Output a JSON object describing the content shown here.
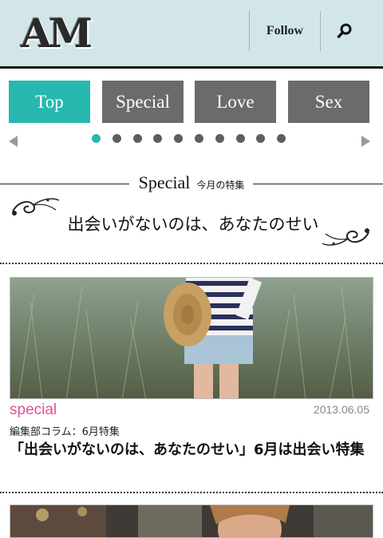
{
  "header": {
    "logo": "AM",
    "follow_label": "Follow",
    "search_icon": "search-icon"
  },
  "tabs": [
    {
      "label": "Top",
      "active": true
    },
    {
      "label": "Special",
      "active": false
    },
    {
      "label": "Love",
      "active": false
    },
    {
      "label": "Sex",
      "active": false
    }
  ],
  "carousel": {
    "dot_count": 10,
    "active_index": 0,
    "prev_icon": "triangle-left-icon",
    "next_icon": "triangle-right-icon"
  },
  "special": {
    "title_en": "Special",
    "title_jp": "今月の特集",
    "banner_text": "出会いがないのは、あなたのせい"
  },
  "article": {
    "category": "special",
    "date": "2013.06.05",
    "subtitle": "編集部コラム：6月特集",
    "title": "「出会いがないのは、あなたのせい」6月は出会い特集"
  },
  "colors": {
    "header_bg": "#d2e6ea",
    "accent_teal": "#27b8b0",
    "tab_gray": "#6b6b6b",
    "category_pink": "#e64e98"
  }
}
